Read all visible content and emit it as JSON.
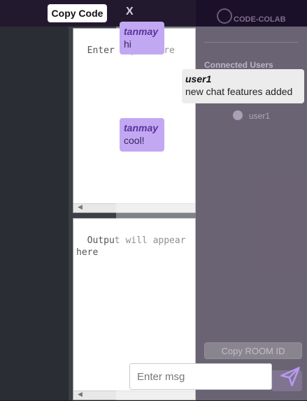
{
  "toolbar": {
    "copy_code_label": "Copy Code",
    "close_label": "X"
  },
  "editor": {
    "input_placeholder": "Enter input here",
    "output_placeholder": "Output will appear here"
  },
  "sidebar": {
    "brand": "CODE-COLAB",
    "heading": "Connected Users",
    "users": [
      "user1"
    ],
    "copy_room_label": "Copy ROOM ID"
  },
  "chat": {
    "messages": [
      {
        "user": "tanmay",
        "text": "hi",
        "self": true
      },
      {
        "user": "user1",
        "text": "new chat features added",
        "self": false
      },
      {
        "user": "tanmay",
        "text": "cool!",
        "self": true
      }
    ],
    "input_placeholder": "Enter msg"
  },
  "colors": {
    "self_bubble": "#c2a8f2",
    "self_name": "#5a329a",
    "other_bubble": "#ececec",
    "accent": "#b79af0"
  },
  "icons": {
    "send": "paper-plane-icon",
    "logo": "code-logo-icon",
    "user": "user-avatar-icon"
  }
}
